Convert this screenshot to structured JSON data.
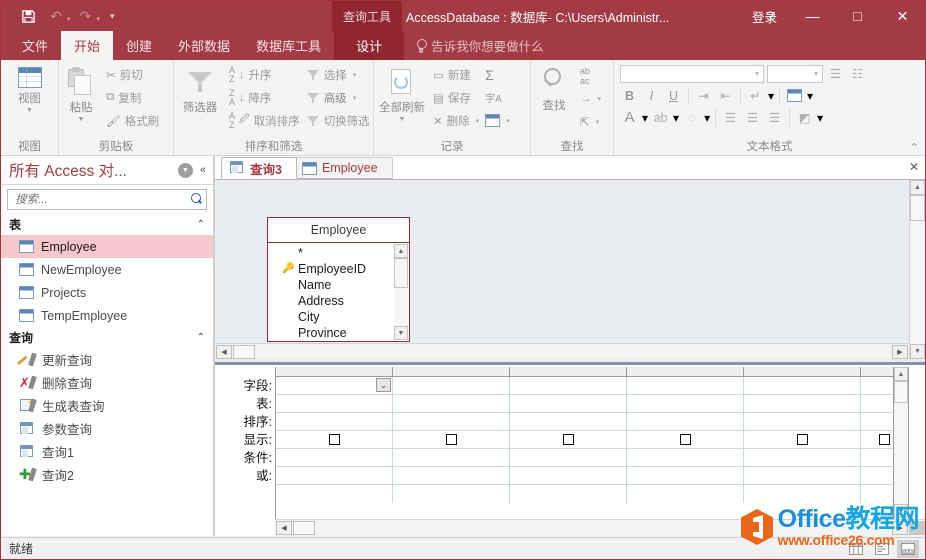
{
  "titlebar": {
    "save_icon": "save-icon",
    "undo_icon": "undo-icon",
    "redo_icon": "redo-icon",
    "customize_icon": "customize-qat-icon",
    "context_tab": "查询工具",
    "window_title": "AccessDatabase : 数据库- C:\\Users\\Administr...",
    "signin": "登录",
    "help": "?",
    "minimize": "—",
    "maximize": "□",
    "close": "✕",
    "bg_color": "#a23b44",
    "context_bg_color": "#90262f"
  },
  "ribbon_tabs": {
    "items": [
      {
        "label": "文件",
        "active": false,
        "context": false
      },
      {
        "label": "开始",
        "active": true,
        "context": false
      },
      {
        "label": "创建",
        "active": false,
        "context": false
      },
      {
        "label": "外部数据",
        "active": false,
        "context": false
      },
      {
        "label": "数据库工具",
        "active": false,
        "context": false
      },
      {
        "label": "设计",
        "active": false,
        "context": true
      }
    ],
    "tell_me": "告诉我你想要做什么"
  },
  "ribbon": {
    "groups": [
      {
        "name": "视图",
        "label": "视图"
      },
      {
        "name": "剪贴板",
        "label": "剪贴板"
      },
      {
        "name": "排序和筛选",
        "label": "排序和筛选"
      },
      {
        "name": "记录",
        "label": "记录"
      },
      {
        "name": "查找",
        "label": "查找"
      },
      {
        "name": "文本格式",
        "label": "文本格式"
      }
    ],
    "view_button": "视图",
    "clipboard": {
      "paste": "粘贴",
      "cut": "剪切",
      "copy": "复制",
      "format_painter": "格式刷"
    },
    "sortfilter": {
      "filter": "筛选器",
      "asc": "升序",
      "desc": "降序",
      "clear_sort": "取消排序",
      "selection": "选择",
      "advanced": "高级",
      "toggle_filter": "切换筛选"
    },
    "records": {
      "refresh_all": "全部刷新",
      "new": "新建",
      "save": "保存",
      "delete": "删除",
      "totals": "Σ",
      "spelling": "字A"
    },
    "find": {
      "find": "查找",
      "replace": "ab/ac",
      "goto": "→",
      "select": "↳"
    },
    "textformat": {
      "bold": "B",
      "italic": "I",
      "underline": "U",
      "font_name": "",
      "font_size": ""
    },
    "collapse_ribbon": "⌃"
  },
  "navpane": {
    "title": "所有 Access 对...",
    "dropdown_icon": "chevron-down-circle-icon",
    "collapse_icon": "double-chevron-left-icon",
    "search_placeholder": "搜索...",
    "search_value": "",
    "groups": [
      {
        "label": "表",
        "items": [
          {
            "label": "Employee",
            "icon": "table-icon",
            "selected": true
          },
          {
            "label": "NewEmployee",
            "icon": "table-icon",
            "selected": false
          },
          {
            "label": "Projects",
            "icon": "table-icon",
            "selected": false
          },
          {
            "label": "TempEmployee",
            "icon": "table-icon",
            "selected": false
          }
        ]
      },
      {
        "label": "查询",
        "items": [
          {
            "label": "更新查询",
            "icon": "update-query-icon",
            "selected": false
          },
          {
            "label": "删除查询",
            "icon": "delete-query-icon",
            "selected": false
          },
          {
            "label": "生成表查询",
            "icon": "make-table-query-icon",
            "selected": false
          },
          {
            "label": "参数查询",
            "icon": "select-query-icon",
            "selected": false
          },
          {
            "label": "查询1",
            "icon": "select-query-icon",
            "selected": false
          },
          {
            "label": "查询2",
            "icon": "append-query-icon",
            "selected": false
          }
        ]
      }
    ]
  },
  "doctabs": {
    "items": [
      {
        "label": "查询3",
        "icon": "query-icon",
        "active": true
      },
      {
        "label": "Employee",
        "icon": "table-icon",
        "active": false
      }
    ],
    "close_label": "✕"
  },
  "design_pane": {
    "table": {
      "title": "Employee",
      "fields": [
        "*",
        "EmployeeID",
        "Name",
        "Address",
        "City",
        "Province"
      ],
      "key_field": "EmployeeID"
    }
  },
  "query_grid": {
    "row_labels": [
      "字段:",
      "表:",
      "排序:",
      "显示:",
      "条件:",
      "或:"
    ],
    "column_count": 6,
    "show_checkboxes": [
      false,
      false,
      false,
      false,
      false,
      false
    ],
    "field_values": [
      "",
      "",
      "",
      "",
      "",
      ""
    ],
    "table_values": [
      "",
      "",
      "",
      "",
      "",
      ""
    ],
    "sort_values": [
      "",
      "",
      "",
      "",
      "",
      ""
    ],
    "criteria_values": [
      "",
      "",
      "",
      "",
      "",
      ""
    ],
    "or_values": [
      "",
      "",
      "",
      "",
      "",
      ""
    ]
  },
  "statusbar": {
    "message": "就绪",
    "view_buttons": [
      "datasheet-view-icon",
      "sql-view-icon",
      "design-view-icon"
    ]
  },
  "watermark": {
    "brand_office": "Office",
    "brand_cn": "教程网",
    "url": "www.office26.com",
    "color_blue": "#1e8fd5",
    "color_cyan": "#18a5e0",
    "color_orange": "#e8671b"
  }
}
